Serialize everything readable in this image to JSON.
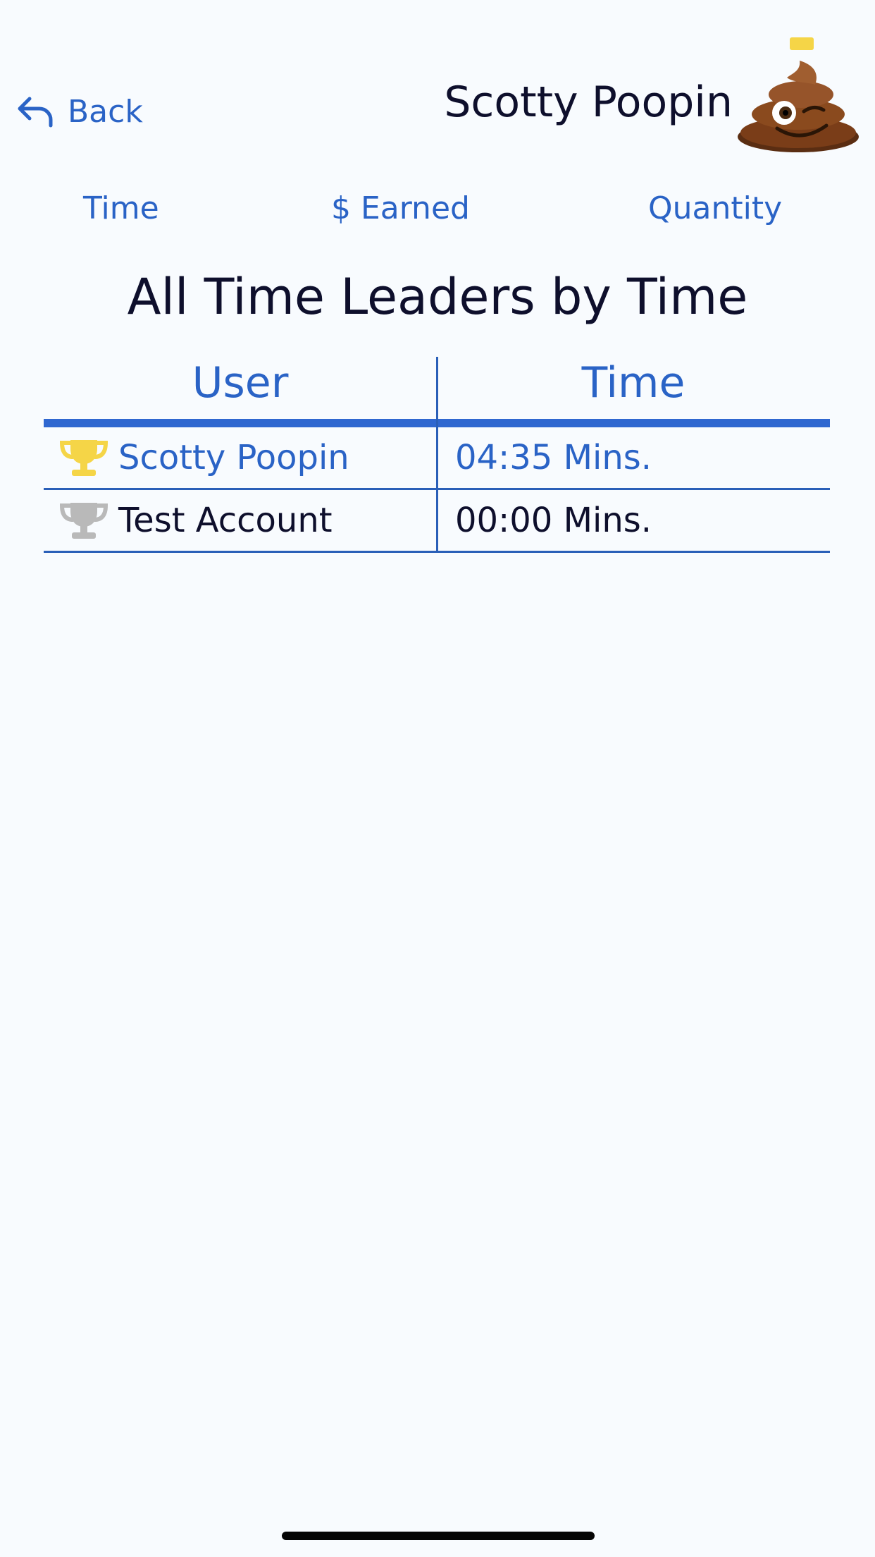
{
  "header": {
    "back_label": "Back",
    "title": "Scotty Poopin",
    "avatar_icon": "poop-emoji-wink-icon"
  },
  "tabs": [
    {
      "label": "Time"
    },
    {
      "label": "$ Earned"
    },
    {
      "label": "Quantity"
    }
  ],
  "section_title": "All Time Leaders by Time",
  "table": {
    "columns": [
      "User",
      "Time"
    ],
    "rows": [
      {
        "user": "Scotty Poopin",
        "time": "04:35 Mins.",
        "trophy": "gold-trophy-icon",
        "highlighted": true
      },
      {
        "user": "Test Account",
        "time": "00:00 Mins.",
        "trophy": "silver-trophy-icon",
        "highlighted": false
      }
    ]
  },
  "colors": {
    "accent": "#2a63c6",
    "text": "#0e0f2c",
    "background": "#f8fbfe",
    "gold": "#f5d547",
    "silver": "#b9b9b9"
  }
}
